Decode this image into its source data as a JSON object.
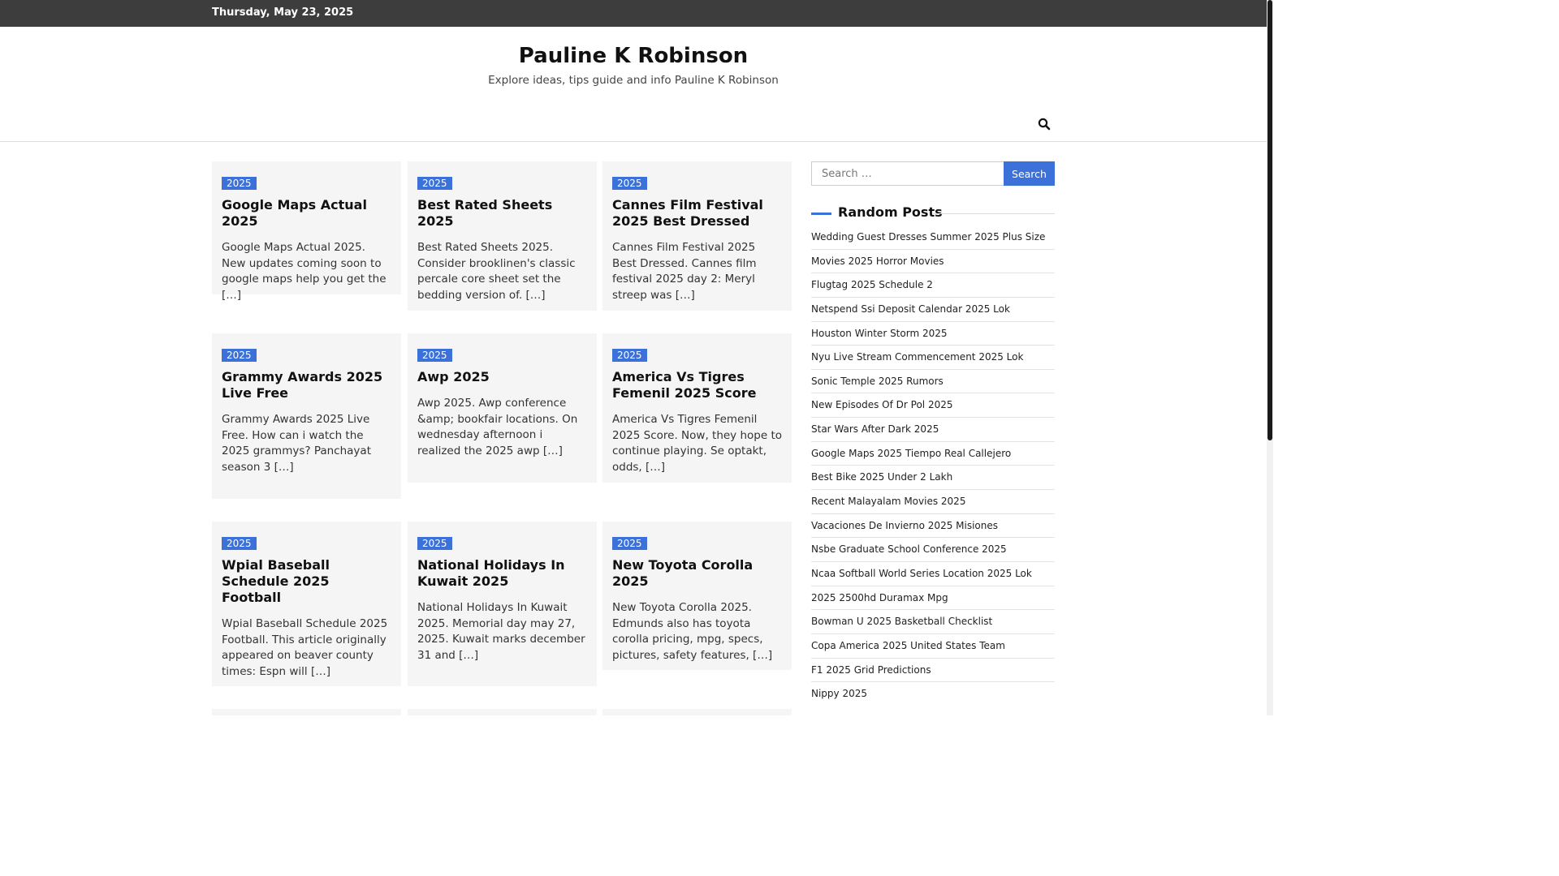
{
  "topbar": {
    "date": "Thursday, May 23, 2025"
  },
  "site": {
    "title": "Pauline K Robinson",
    "description": "Explore ideas, tips guide and info Pauline K Robinson"
  },
  "nav": {
    "search_icon": "search-icon"
  },
  "posts": [
    {
      "category": "2025",
      "title": "Google Maps Actual 2025",
      "excerpt": "Google Maps Actual 2025. New updates coming soon to google maps help you get the […]"
    },
    {
      "category": "2025",
      "title": "Best Rated Sheets 2025",
      "excerpt": "Best Rated Sheets 2025. Consider brooklinen's classic percale core sheet set the bedding version of. […]"
    },
    {
      "category": "2025",
      "title": "Cannes Film Festival 2025 Best Dressed",
      "excerpt": "Cannes Film Festival 2025 Best Dressed. Cannes film festival 2025 day 2: Meryl streep was […]"
    },
    {
      "category": "2025",
      "title": "Grammy Awards 2025 Live Free",
      "excerpt": "Grammy Awards 2025 Live Free. How can i watch the 2025 grammys? Panchayat season 3 […]"
    },
    {
      "category": "2025",
      "title": "Awp 2025",
      "excerpt": "Awp 2025. Awp conference &amp; bookfair locations. On wednesday afternoon i realized the 2025 awp […]"
    },
    {
      "category": "2025",
      "title": "America Vs Tigres Femenil 2025 Score",
      "excerpt": "America Vs Tigres Femenil 2025 Score. Now, they hope to continue playing. Se optakt, odds, […]"
    },
    {
      "category": "2025",
      "title": "Wpial Baseball Schedule 2025 Football",
      "excerpt": "Wpial Baseball Schedule 2025 Football. This article originally appeared on beaver county times: Espn will […]"
    },
    {
      "category": "2025",
      "title": "National Holidays In Kuwait 2025",
      "excerpt": "National Holidays In Kuwait 2025. Memorial day may 27, 2025. Kuwait marks december 31 and […]"
    },
    {
      "category": "2025",
      "title": "New Toyota Corolla 2025",
      "excerpt": "New Toyota Corolla 2025. Edmunds also has toyota corolla pricing, mpg, specs, pictures, safety features, […]"
    }
  ],
  "sidebar": {
    "search": {
      "placeholder": "Search …",
      "button_label": "Search"
    },
    "random_posts": {
      "title": "Random Posts",
      "items": [
        "Wedding Guest Dresses Summer 2025 Plus Size",
        "Movies 2025 Horror Movies",
        "Flugtag 2025 Schedule 2",
        "Netspend Ssi Deposit Calendar 2025 Lok",
        "Houston Winter Storm 2025",
        "Nyu Live Stream Commencement 2025 Lok",
        "Sonic Temple 2025 Rumors",
        "New Episodes Of Dr Pol 2025",
        "Star Wars After Dark 2025",
        "Google Maps 2025 Tiempo Real Callejero",
        "Best Bike 2025 Under 2 Lakh",
        "Recent Malayalam Movies 2025",
        "Vacaciones De Invierno 2025 Misiones",
        "Nsbe Graduate School Conference 2025",
        "Ncaa Softball World Series Location 2025 Lok",
        "2025 2500hd Duramax Mpg",
        "Bowman U 2025 Basketball Checklist",
        "Copa America 2025 United States Team",
        "F1 2025 Grid Predictions",
        "Nippy 2025"
      ]
    }
  },
  "colors": {
    "accent": "#3b71d8",
    "topbar": "#3d3d3d",
    "card_bg": "#f5f5f5"
  }
}
